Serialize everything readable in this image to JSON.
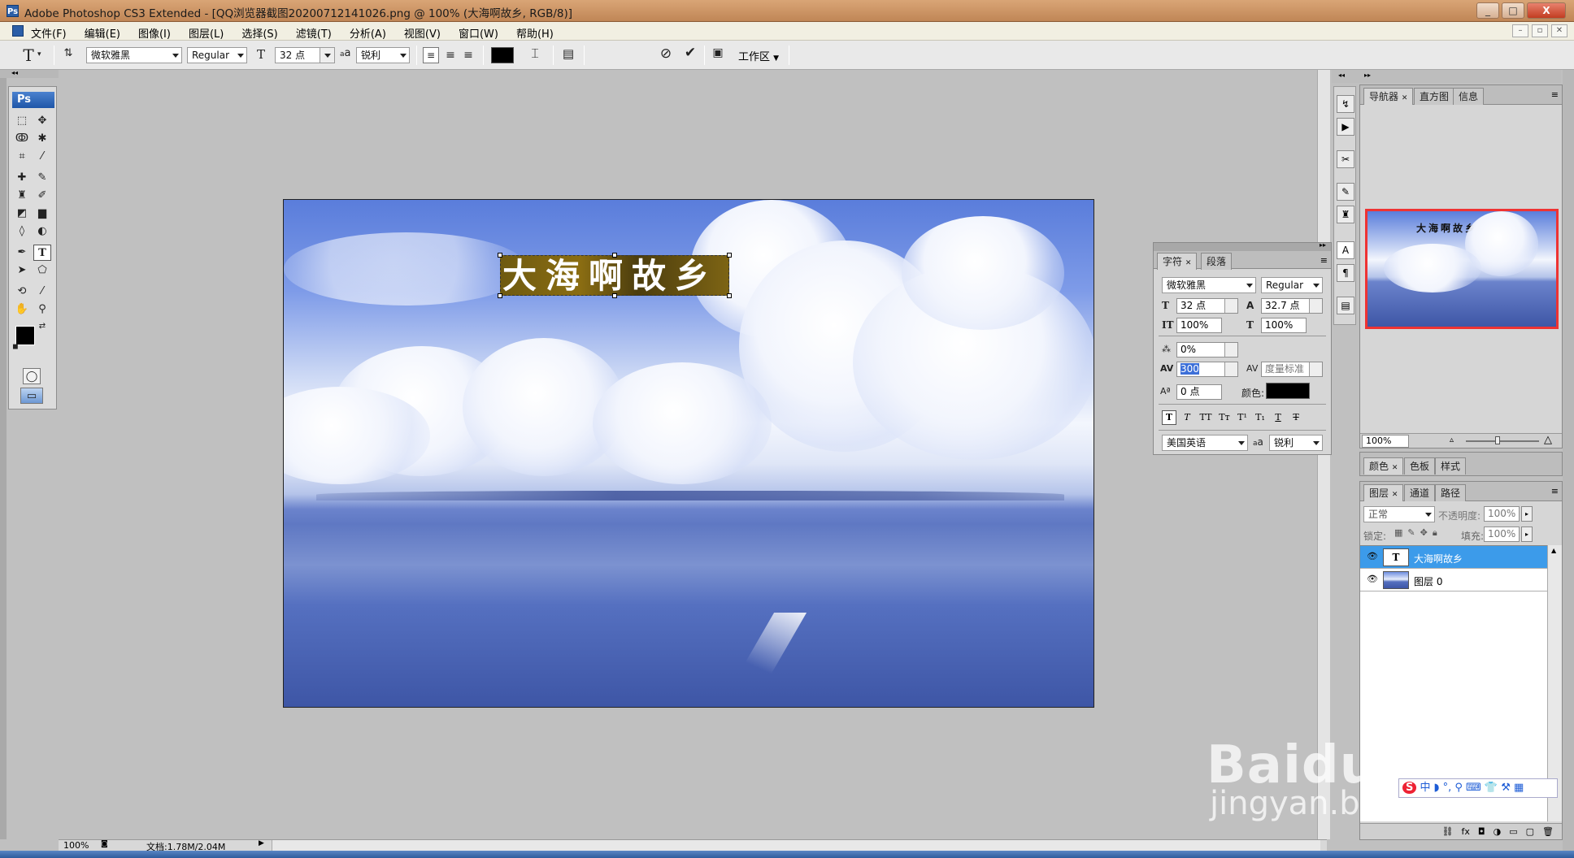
{
  "window": {
    "title": "Adobe Photoshop CS3 Extended - [QQ浏览器截图20200712141026.png @ 100% (大海啊故乡, RGB/8)]",
    "ps_icon_label": "Ps",
    "minimize": "_",
    "maximize": "□",
    "close": "X"
  },
  "menubar": {
    "items": [
      "文件(F)",
      "编辑(E)",
      "图像(I)",
      "图层(L)",
      "选择(S)",
      "滤镜(T)",
      "分析(A)",
      "视图(V)",
      "窗口(W)",
      "帮助(H)"
    ]
  },
  "options": {
    "font_family": "微软雅黑",
    "font_style": "Regular",
    "font_size": "32 点",
    "aa_label": "a",
    "antialias": "锐利",
    "workspace": "工作区"
  },
  "tools": {
    "logo": "Ps"
  },
  "character_panel": {
    "tabs": [
      "字符",
      "段落"
    ],
    "font_family": "微软雅黑",
    "font_style": "Regular",
    "font_size": "32 点",
    "leading": "32.7 点",
    "vertical_scale": "100%",
    "horizontal_scale": "100%",
    "tsume": "0%",
    "tracking": "300",
    "kerning": "度量标准",
    "baseline_shift": "0 点",
    "color_label": "颜色:",
    "color": "#000000",
    "language": "美国英语",
    "aa_label": "a",
    "antialias": "锐利"
  },
  "navigator_panel": {
    "tabs": [
      "导航器",
      "直方图",
      "信息"
    ],
    "zoom": "100%"
  },
  "color_panel": {
    "tabs": [
      "颜色",
      "色板",
      "样式"
    ]
  },
  "layers_panel": {
    "tabs": [
      "图层",
      "通道",
      "路径"
    ],
    "blend_mode": "正常",
    "opacity_label": "不透明度:",
    "opacity": "100%",
    "lock_label": "锁定:",
    "fill_label": "填充:",
    "fill": "100%",
    "layers": [
      {
        "name": "大海啊故乡",
        "type": "text",
        "thumb": "T",
        "selected": true
      },
      {
        "name": "图层 0",
        "type": "image",
        "selected": false
      }
    ]
  },
  "canvas": {
    "text": "大海啊故乡"
  },
  "status": {
    "zoom": "100%",
    "doc_info": "文档:1.78M/2.04M"
  },
  "watermark": {
    "brand": "Baidu经验",
    "url": "jingyan.baidu.com"
  },
  "colors": {
    "selection_blue": "#3c9bea",
    "title_bar": "#c98e5e",
    "panel_bg": "#d6d6d6"
  }
}
